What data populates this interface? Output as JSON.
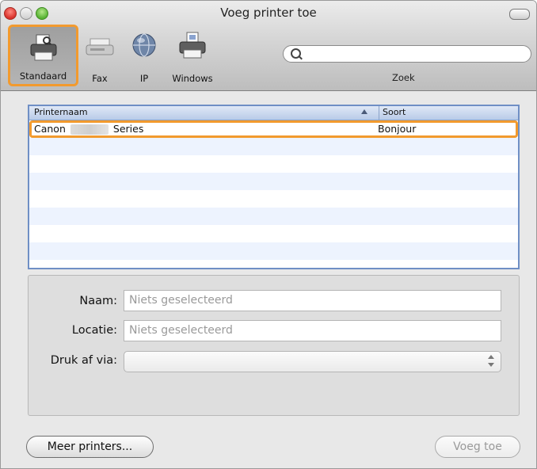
{
  "window": {
    "title": "Voeg printer toe"
  },
  "toolbar": {
    "items": [
      {
        "label": "Standaard",
        "icon": "printer-icon",
        "selected": true
      },
      {
        "label": "Fax",
        "icon": "fax-icon",
        "selected": false
      },
      {
        "label": "IP",
        "icon": "globe-icon",
        "selected": false
      },
      {
        "label": "Windows",
        "icon": "windows-printer-icon",
        "selected": false
      }
    ],
    "search": {
      "value": "",
      "label": "Zoek"
    }
  },
  "printer_list": {
    "columns": [
      "Printernaam",
      "Soort"
    ],
    "sort_column": "Printernaam",
    "rows": [
      {
        "name_prefix": "Canon",
        "name_suffix": "Series",
        "kind": "Bonjour",
        "highlighted": true
      }
    ]
  },
  "details": {
    "name_label": "Naam:",
    "name_value": "Niets geselecteerd",
    "location_label": "Locatie:",
    "location_value": "Niets geselecteerd",
    "print_via_label": "Druk af via:",
    "print_via_value": ""
  },
  "buttons": {
    "more_printers": "Meer printers...",
    "add": "Voeg toe"
  },
  "colors": {
    "highlight": "#f29a2e",
    "list_border": "#6f8fc5",
    "alt_row": "#edf3fe"
  }
}
